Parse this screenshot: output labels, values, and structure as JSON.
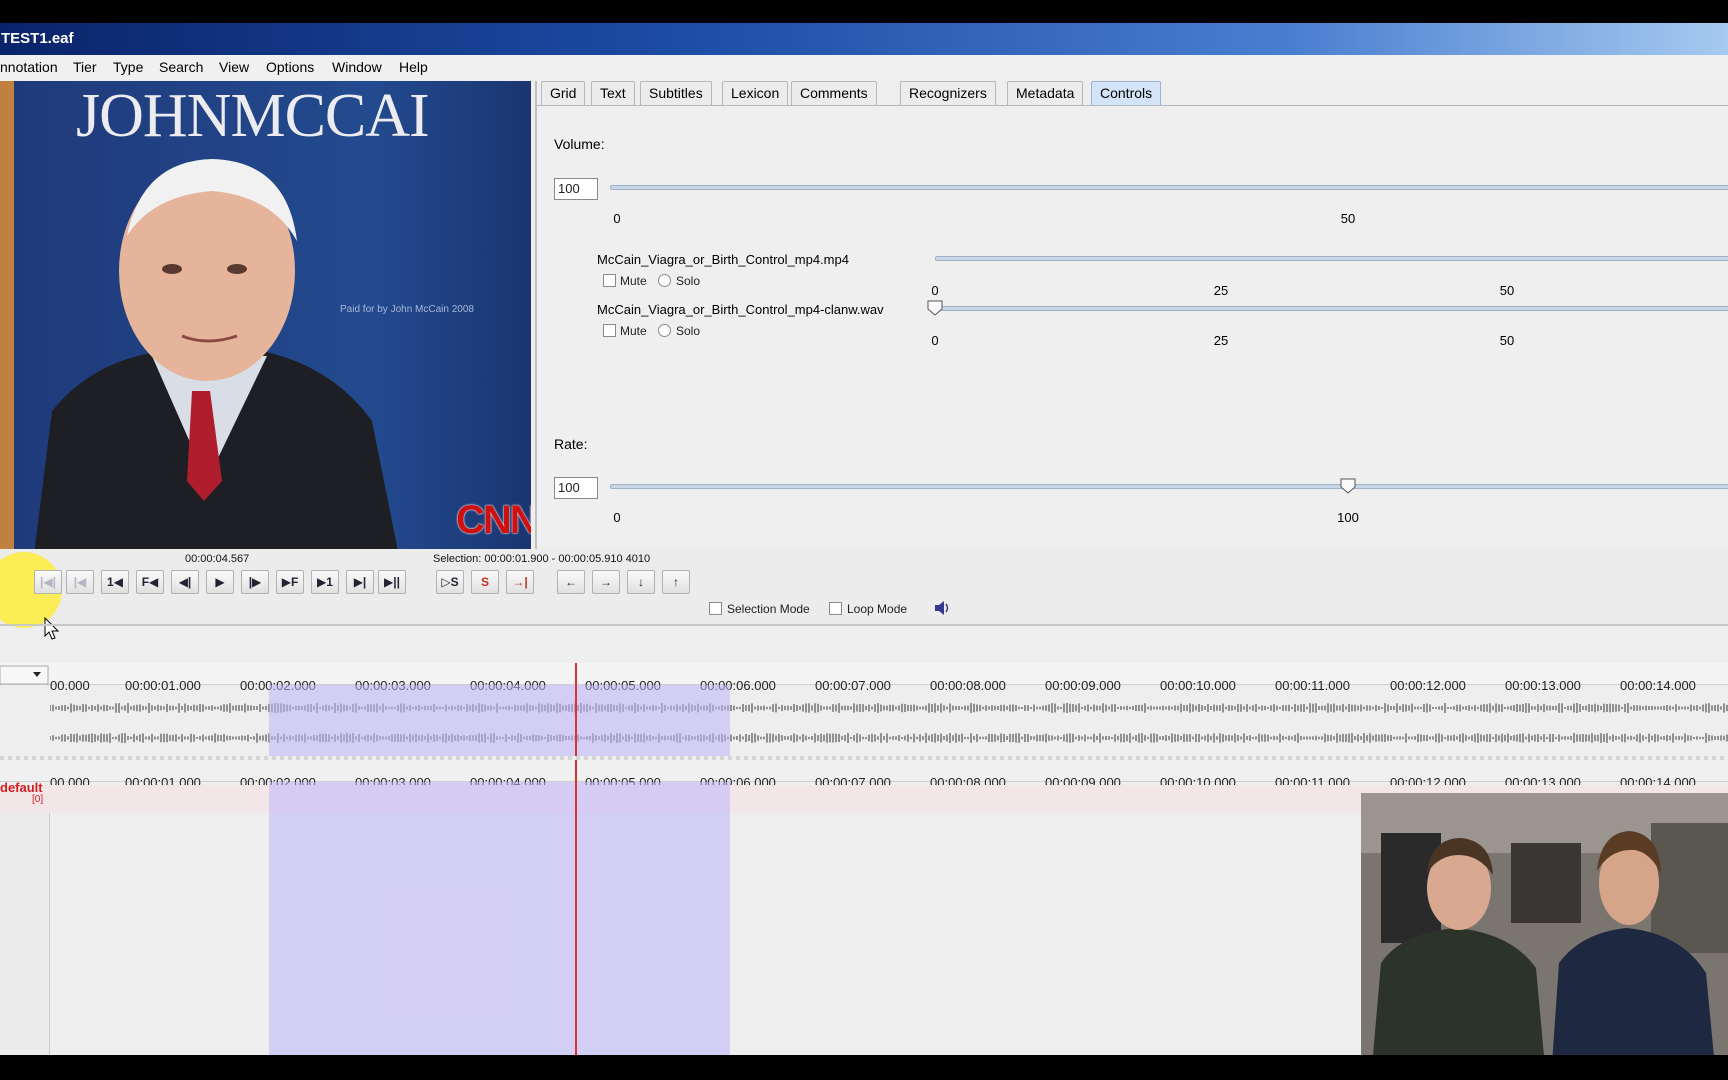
{
  "window": {
    "title": "TEST1.eaf"
  },
  "menu": [
    "nnotation",
    "Tier",
    "Type",
    "Search",
    "View",
    "Options",
    "Window",
    "Help"
  ],
  "video": {
    "banner": "JOHNMCCAI",
    "poster_note": "Paid for by John McCain 2008",
    "logo": "CNN"
  },
  "tabs": [
    {
      "label": "Grid",
      "active": false
    },
    {
      "label": "Text",
      "active": false
    },
    {
      "label": "Subtitles",
      "active": false
    },
    {
      "label": "Lexicon",
      "active": false
    },
    {
      "label": "Comments",
      "active": false
    },
    {
      "label": "Recognizers",
      "active": false
    },
    {
      "label": "Metadata",
      "active": false
    },
    {
      "label": "Controls",
      "active": true
    }
  ],
  "controls": {
    "volume": {
      "label": "Volume:",
      "value": "100",
      "ticks": [
        "0",
        "50"
      ]
    },
    "media": [
      {
        "name": "McCain_Viagra_or_Birth_Control_mp4.mp4",
        "mute": "Mute",
        "solo": "Solo",
        "ticks": [
          "0",
          "25",
          "50"
        ]
      },
      {
        "name": "McCain_Viagra_or_Birth_Control_mp4-clanw.wav",
        "mute": "Mute",
        "solo": "Solo",
        "ticks": [
          "0",
          "25",
          "50"
        ],
        "level": 0
      }
    ],
    "rate": {
      "label": "Rate:",
      "value": "100",
      "ticks": [
        "0",
        "100"
      ],
      "level": 100
    }
  },
  "player": {
    "current_time": "00:00:04.567",
    "selection": "Selection: 00:00:01.900 - 00:00:05.910  4010",
    "selection_mode": "Selection Mode",
    "loop_mode": "Loop Mode",
    "buttons": [
      "|◀|",
      "|◀",
      "1◀",
      "F◀",
      "◀|",
      "▶",
      "|▶",
      "▶F",
      "▶1",
      "▶|",
      "▶||",
      "▷S",
      "S",
      "→|",
      "←",
      "→",
      "↓",
      "↑"
    ]
  },
  "timeline": {
    "labels": [
      "00.000",
      "00:00:01.000",
      "00:00:02.000",
      "00:00:03.000",
      "00:00:04.000",
      "00:00:05.000",
      "00:00:06.000",
      "00:00:07.000",
      "00:00:08.000",
      "00:00:09.000",
      "00:00:10.000",
      "00:00:11.000",
      "00:00:12.000",
      "00:00:13.000",
      "00:00:14.000"
    ],
    "tier_name": "default",
    "tier_count": "[0]",
    "selection_start_s": 1.9,
    "selection_end_s": 5.91,
    "playhead_s": 4.567
  }
}
